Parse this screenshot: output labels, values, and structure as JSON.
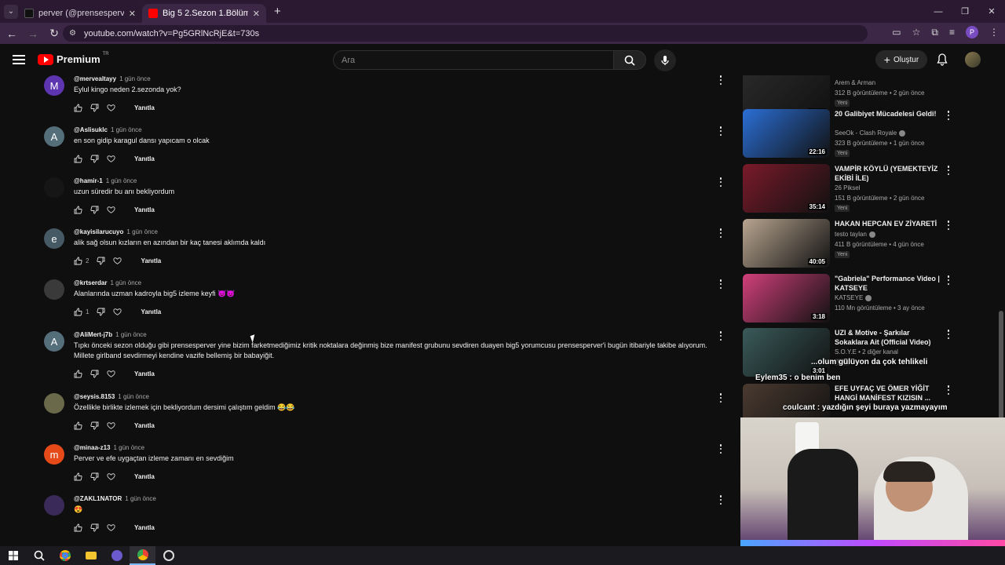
{
  "browser": {
    "tabs": [
      {
        "title": "perver (@prensesperver) | TikTo",
        "active": false,
        "favicon_color": "#111111"
      },
      {
        "title": "Big 5 2.Sezon 1.Bölüm | Perver &",
        "active": true,
        "favicon_color": "#ff0000"
      }
    ],
    "url": "youtube.com/watch?v=Pg5GRlNcRjE&t=730s",
    "profile_initial": "P"
  },
  "youtube": {
    "brand": "Premium",
    "country": "TR",
    "search_placeholder": "Ara",
    "create_label": "Oluştur"
  },
  "comments": [
    {
      "avatar_letter": "M",
      "avatar_color": "#5e35b1",
      "handle": "@mervealtayy",
      "time": "1 gün önce",
      "text": "Eylul kingo neden 2.sezonda yok?",
      "likes": "",
      "reply": "Yanıtla"
    },
    {
      "avatar_letter": "A",
      "avatar_color": "#546e7a",
      "handle": "@Aslisuklc",
      "time": "1 gün önce",
      "text": "en son gidip karagul dansı yapıcam o olcak",
      "likes": "",
      "reply": "Yanıtla"
    },
    {
      "avatar_letter": "",
      "avatar_color": "#161616",
      "handle": "@hamir-1",
      "time": "1 gün önce",
      "text": "uzun süredir bu anı bekliyordum",
      "likes": "",
      "reply": "Yanıtla"
    },
    {
      "avatar_letter": "e",
      "avatar_color": "#455a64",
      "handle": "@kayisilarucuyo",
      "time": "1 gün önce",
      "text": "alik sağ olsun kızların en azından bir kaç tanesi aklımda kaldı",
      "likes": "2",
      "reply": "Yanıtla"
    },
    {
      "avatar_letter": "",
      "avatar_color": "#3a3a3a",
      "handle": "@krtserdar",
      "time": "1 gün önce",
      "text": "Alanlarında uzman kadroyla big5 izleme keyfi 😈😈",
      "likes": "1",
      "reply": "Yanıtla"
    },
    {
      "avatar_letter": "A",
      "avatar_color": "#546e7a",
      "handle": "@AliMert-j7b",
      "time": "1 gün önce",
      "text": "Tıpkı önceki sezon olduğu gibi prensesperver yine bizim farketmediğimiz kritik noktalara değinmiş bize manifest grubunu sevdiren duayen big5 yorumcusu prensesperver'i bugün itibariyle takibe alıyorum. Millete girlband sevdirmeyi kendine vazife bellemiş bir babayiğit.",
      "likes": "",
      "reply": "Yanıtla"
    },
    {
      "avatar_letter": "",
      "avatar_color": "#6a6a4a",
      "handle": "@seysis.8153",
      "time": "1 gün önce",
      "text": "Özellikle birlikte izlemek için bekliyordum dersimi çalıştım geldim 😂😂",
      "likes": "",
      "reply": "Yanıtla"
    },
    {
      "avatar_letter": "m",
      "avatar_color": "#e64a19",
      "handle": "@minaa-z13",
      "time": "1 gün önce",
      "text": "Perver ve efe uygaçtan izleme zamanı en sevdiğim",
      "likes": "",
      "reply": "Yanıtla"
    },
    {
      "avatar_letter": "",
      "avatar_color": "#3a2a5a",
      "handle": "@ZAKL1NATOR",
      "time": "1 gün önce",
      "text": "😍",
      "likes": "",
      "reply": "Yanıtla"
    }
  ],
  "recommended": [
    {
      "title": "",
      "channel": "Arem & Arman",
      "views": "312 B görüntüleme • 2 gün önce",
      "duration": "52:58",
      "badge": "Yeni",
      "verified": false,
      "thumb_color": "#2a2a2a"
    },
    {
      "title": "20 Galibiyet Mücadelesi Geldi!",
      "channel": "SeeOk - Clash Royale",
      "views": "323 B görüntüleme • 1 gün önce",
      "duration": "22:16",
      "badge": "Yeni",
      "verified": true,
      "thumb_color": "#2b6fd6"
    },
    {
      "title": "VAMPİR KÖYLÜ (YEMEKTEYİZ EKİBİ İLE)",
      "channel": "26 Piksel",
      "views": "151 B görüntüleme • 2 gün önce",
      "duration": "35:14",
      "badge": "Yeni",
      "verified": false,
      "thumb_color": "#7a1a2a"
    },
    {
      "title": "HAKAN HEPCAN EV ZİYARETİ",
      "channel": "testo taylan",
      "views": "411 B görüntüleme • 4 gün önce",
      "duration": "40:05",
      "badge": "Yeni",
      "verified": true,
      "thumb_color": "#b8a590"
    },
    {
      "title": "\"Gabriela\" Performance Video | KATSEYE",
      "channel": "KATSEYE",
      "views": "110 Mn görüntüleme • 3 ay önce",
      "duration": "3:18",
      "badge": "",
      "verified": true,
      "thumb_color": "#d0407a"
    },
    {
      "title": "UZI & Motive - Şarkılar Sokaklara Ait (Official Video)",
      "channel": "S.O.Y.E • 2 diğer kanal",
      "views": "",
      "duration": "3:01",
      "badge": "Yeni",
      "verified": false,
      "thumb_color": "#3a5a5a"
    },
    {
      "title": "EFE UYFAÇ VE ÖMER YİĞİT HANGİ MANİFEST KIZISIN ...",
      "channel": "",
      "views": "",
      "duration": "",
      "badge": "",
      "verified": false,
      "thumb_color": "#4a3a30"
    }
  ],
  "overlay_chat": [
    {
      "text": "...olum gülüyon da çok tehlikeli"
    },
    {
      "text": "Eylem35 : o benim ben"
    },
    {
      "text": "coulcant : yazdığın şeyi buraya yazmayayım"
    }
  ]
}
